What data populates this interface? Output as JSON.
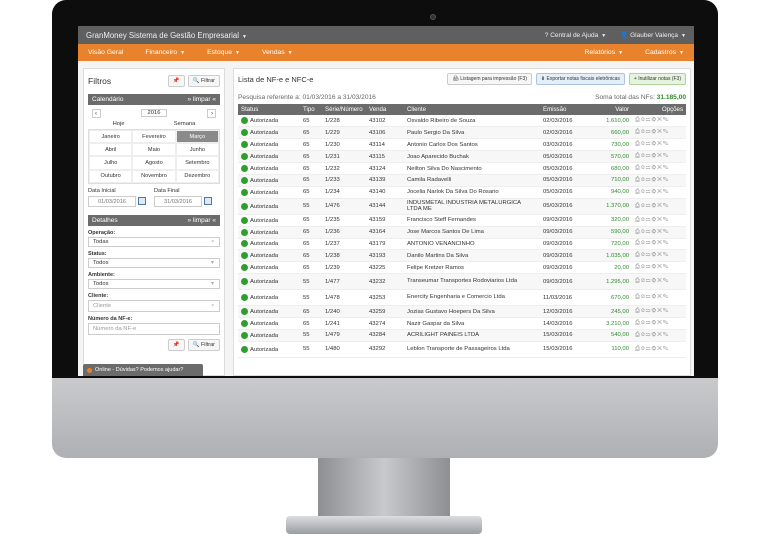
{
  "header": {
    "app_title": "GranMoney Sistema de Gestão Empresarial",
    "help_label": "Central de Ajuda",
    "user_label": "Glauber Valença"
  },
  "menu": {
    "items": [
      "Visão Geral",
      "Financeiro",
      "Estoque",
      "Vendas"
    ],
    "right_items": [
      "Relatórios",
      "Cadastros"
    ]
  },
  "filters": {
    "title": "Filtros",
    "filter_button": "Filtrar",
    "calendar": {
      "title": "Calendário",
      "clear": "limpar",
      "year": "2016",
      "options": [
        "Hoje",
        "Semana"
      ],
      "months": [
        "Janeiro",
        "Fevereiro",
        "Março",
        "Abril",
        "Maio",
        "Junho",
        "Julho",
        "Agosto",
        "Setembro",
        "Outubro",
        "Novembro",
        "Dezembro"
      ],
      "selected_month": "Março",
      "start_label": "Data Inicial",
      "start_value": "01/03/2016",
      "end_label": "Data Final",
      "end_value": "31/03/2016"
    },
    "details": {
      "title": "Detalhes",
      "clear": "limpar",
      "operacao_label": "Operação:",
      "operacao_value": "Todas",
      "status_label": "Status:",
      "status_value": "Todos",
      "ambiente_label": "Ambiente:",
      "ambiente_value": "Todos",
      "cliente_label": "Cliente:",
      "cliente_placeholder": "Cliente",
      "numero_label": "Número da NF-e:",
      "numero_placeholder": "Número da NF-e"
    }
  },
  "chat": {
    "label": "Online - Dúvidas? Podemos ajudar?"
  },
  "list": {
    "title": "Lista de NF-e e NFC-e",
    "print_button": "Listagem para impressão (F3)",
    "export_button": "Exportar notas fiscais eletrônicas",
    "void_button": "Inutilizar notas (F3)",
    "period_text": "Pesquisa referente a: 01/03/2016 a 31/03/2016",
    "total_label": "Soma total das NFs:",
    "total_value": "31.185,00",
    "columns": [
      "Status",
      "Tipo",
      "Série/Número",
      "Venda",
      "Cliente",
      "Emissão",
      "Valor",
      "Opções"
    ],
    "rows": [
      {
        "status": "Autorizada",
        "tipo": "65",
        "serie": "1/228",
        "venda": "43102",
        "cliente": "Osvaldo Ribeiro de Souza",
        "emissao": "02/03/2016",
        "valor": "1.610,00"
      },
      {
        "status": "Autorizada",
        "tipo": "65",
        "serie": "1/229",
        "venda": "43106",
        "cliente": "Paulo Sergio Da Silva",
        "emissao": "02/03/2016",
        "valor": "660,00"
      },
      {
        "status": "Autorizada",
        "tipo": "65",
        "serie": "1/230",
        "venda": "43114",
        "cliente": "Antonio Carlos Dos Santos",
        "emissao": "03/03/2016",
        "valor": "730,00"
      },
      {
        "status": "Autorizada",
        "tipo": "65",
        "serie": "1/231",
        "venda": "43115",
        "cliente": "Joao Aparecido Buchak",
        "emissao": "05/03/2016",
        "valor": "570,00"
      },
      {
        "status": "Autorizada",
        "tipo": "65",
        "serie": "1/232",
        "venda": "43124",
        "cliente": "Neilton Silva Do Nascimento",
        "emissao": "05/03/2016",
        "valor": "680,00"
      },
      {
        "status": "Autorizada",
        "tipo": "65",
        "serie": "1/233",
        "venda": "43139",
        "cliente": "Camila Radavelli",
        "emissao": "05/03/2016",
        "valor": "710,00"
      },
      {
        "status": "Autorizada",
        "tipo": "65",
        "serie": "1/234",
        "venda": "43140",
        "cliente": "Jocelia Narlok Da Silva Do Rosario",
        "emissao": "05/03/2016",
        "valor": "940,00"
      },
      {
        "status": "Autorizada",
        "tipo": "55",
        "serie": "1/476",
        "venda": "43144",
        "cliente": "INDUSMETAL INDUSTRIA METALURGICA LTDA ME",
        "emissao": "05/03/2016",
        "valor": "1.370,00"
      },
      {
        "status": "Autorizada",
        "tipo": "65",
        "serie": "1/235",
        "venda": "43159",
        "cliente": "Francisco Steff Fernandes",
        "emissao": "09/03/2016",
        "valor": "320,00"
      },
      {
        "status": "Autorizada",
        "tipo": "65",
        "serie": "1/236",
        "venda": "43164",
        "cliente": "Jose Marcos Santos De Lima",
        "emissao": "09/03/2016",
        "valor": "590,00"
      },
      {
        "status": "Autorizada",
        "tipo": "65",
        "serie": "1/237",
        "venda": "43179",
        "cliente": "ANTONIO VENANCINHO",
        "emissao": "09/03/2016",
        "valor": "720,00"
      },
      {
        "status": "Autorizada",
        "tipo": "65",
        "serie": "1/238",
        "venda": "43193",
        "cliente": "Danilo Martins Da Silva",
        "emissao": "09/03/2016",
        "valor": "1.035,00"
      },
      {
        "status": "Autorizada",
        "tipo": "65",
        "serie": "1/239",
        "venda": "43225",
        "cliente": "Felipe Kretzer Ramos",
        "emissao": "09/03/2016",
        "valor": "20,00"
      },
      {
        "status": "Autorizada",
        "tipo": "55",
        "serie": "1/477",
        "venda": "43232",
        "cliente": "Transeumar Transportes Rodoviarios Ltda",
        "emissao": "09/03/2016",
        "valor": "1.295,00"
      },
      {
        "status": "Autorizada",
        "tipo": "55",
        "serie": "1/478",
        "venda": "43253",
        "cliente": "Enercity Engenharia e Comercio Ltda",
        "emissao": "11/03/2016",
        "valor": "670,00"
      },
      {
        "status": "Autorizada",
        "tipo": "65",
        "serie": "1/240",
        "venda": "43259",
        "cliente": "Jozias Gustavo Hoepers Da Silva",
        "emissao": "12/03/2016",
        "valor": "245,00"
      },
      {
        "status": "Autorizada",
        "tipo": "65",
        "serie": "1/241",
        "venda": "43274",
        "cliente": "Nazir Gaspar da Silva",
        "emissao": "14/03/2016",
        "valor": "3.210,00"
      },
      {
        "status": "Autorizada",
        "tipo": "55",
        "serie": "1/479",
        "venda": "43284",
        "cliente": "ACRILIGHT PAINEIS LTDA",
        "emissao": "15/03/2016",
        "valor": "540,00"
      },
      {
        "status": "Autorizada",
        "tipo": "55",
        "serie": "1/480",
        "venda": "43292",
        "cliente": "Leblon Transporte de Passageiros Ltda",
        "emissao": "15/03/2016",
        "valor": "110,00"
      }
    ]
  }
}
